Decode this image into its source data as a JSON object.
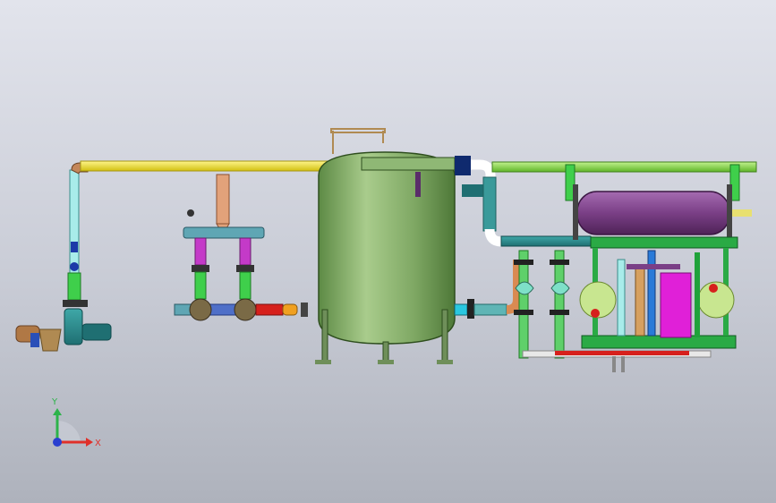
{
  "view": {
    "colors": {
      "background_top": "#e2e4ec",
      "background_bottom": "#aeb2bc",
      "supply_pipe": "#f0e020",
      "return_pipe": "#7ed63c",
      "vessel": "#7fa864",
      "heat_exchanger": "#7a3f86",
      "skid_frame": "#1fa23a"
    }
  },
  "triad": {
    "y_label": "Y",
    "x_label": "X",
    "y_color": "#2db34a",
    "x_color": "#e0302a",
    "z_color": "#2a3fd0"
  }
}
